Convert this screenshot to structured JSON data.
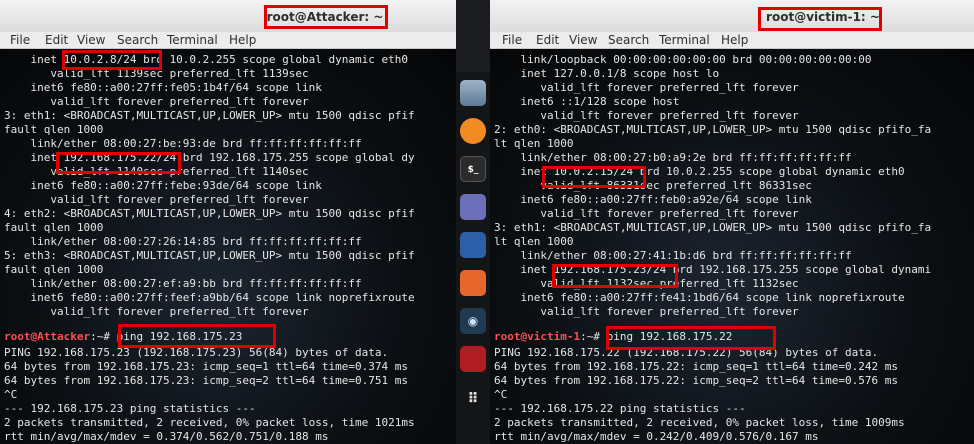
{
  "left_window": {
    "title": "root@Attacker: ~",
    "menu": [
      "File",
      "Edit",
      "View",
      "Search",
      "Terminal",
      "Help"
    ],
    "lines": [
      "    inet 10.0.2.8/24 brd 10.0.2.255 scope global dynamic eth0",
      "       valid_lft 1139sec preferred_lft 1139sec",
      "    inet6 fe80::a00:27ff:fe05:1b4f/64 scope link",
      "       valid_lft forever preferred_lft forever",
      "3: eth1: <BROADCAST,MULTICAST,UP,LOWER_UP> mtu 1500 qdisc pfif",
      "fault qlen 1000",
      "    link/ether 08:00:27:be:93:de brd ff:ff:ff:ff:ff:ff",
      "    inet 192.168.175.22/24 brd 192.168.175.255 scope global dy",
      "       valid_lft 1140sec preferred_lft 1140sec",
      "    inet6 fe80::a00:27ff:febe:93de/64 scope link",
      "       valid_lft forever preferred_lft forever",
      "4: eth2: <BROADCAST,MULTICAST,UP,LOWER_UP> mtu 1500 qdisc pfif",
      "fault qlen 1000",
      "    link/ether 08:00:27:26:14:85 brd ff:ff:ff:ff:ff:ff",
      "5: eth3: <BROADCAST,MULTICAST,UP,LOWER_UP> mtu 1500 qdisc pfif",
      "fault qlen 1000",
      "    link/ether 08:00:27:ef:a9:bb brd ff:ff:ff:ff:ff:ff",
      "    inet6 fe80::a00:27ff:feef:a9bb/64 scope link noprefixroute",
      "       valid_lft forever preferred_lft forever"
    ],
    "prompt": "root@Attacker",
    "prompt_rest": ":~# ping 192.168.175.23",
    "output_lines": [
      "PING 192.168.175.23 (192.168.175.23) 56(84) bytes of data.",
      "64 bytes from 192.168.175.23: icmp_seq=1 ttl=64 time=0.374 ms",
      "64 bytes from 192.168.175.23: icmp_seq=2 ttl=64 time=0.751 ms",
      "^C",
      "--- 192.168.175.23 ping statistics ---",
      "2 packets transmitted, 2 received, 0% packet loss, time 1021ms",
      "rtt min/avg/max/mdev = 0.374/0.562/0.751/0.188 ms"
    ]
  },
  "right_window": {
    "title": "root@victim-1: ~",
    "menu": [
      "File",
      "Edit",
      "View",
      "Search",
      "Terminal",
      "Help"
    ],
    "lines": [
      "    link/loopback 00:00:00:00:00:00 brd 00:00:00:00:00:00",
      "    inet 127.0.0.1/8 scope host lo",
      "       valid_lft forever preferred_lft forever",
      "    inet6 ::1/128 scope host",
      "       valid_lft forever preferred_lft forever",
      "2: eth0: <BROADCAST,MULTICAST,UP,LOWER_UP> mtu 1500 qdisc pfifo_fa",
      "lt qlen 1000",
      "    link/ether 08:00:27:b0:a9:2e brd ff:ff:ff:ff:ff:ff",
      "    inet 10.0.2.15/24 brd 10.0.2.255 scope global dynamic eth0",
      "       valid_lft 86331sec preferred_lft 86331sec",
      "    inet6 fe80::a00:27ff:feb0:a92e/64 scope link",
      "       valid_lft forever preferred_lft forever",
      "3: eth1: <BROADCAST,MULTICAST,UP,LOWER_UP> mtu 1500 qdisc pfifo_fa",
      "lt qlen 1000",
      "    link/ether 08:00:27:41:1b:d6 brd ff:ff:ff:ff:ff:ff",
      "    inet 192.168.175.23/24 brd 192.168.175.255 scope global dynami",
      "       valid_lft 1132sec preferred_lft 1132sec",
      "    inet6 fe80::a00:27ff:fe41:1bd6/64 scope link noprefixroute",
      "       valid_lft forever preferred_lft forever"
    ],
    "prompt": "root@victim-1",
    "prompt_rest": ":~# ping 192.168.175.22",
    "output_lines": [
      "PING 192.168.175.22 (192.168.175.22) 56(84) bytes of data.",
      "64 bytes from 192.168.175.22: icmp_seq=1 ttl=64 time=0.242 ms",
      "64 bytes from 192.168.175.22: icmp_seq=2 ttl=64 time=0.576 ms",
      "^C",
      "--- 192.168.175.22 ping statistics ---",
      "2 packets transmitted, 2 received, 0% packet loss, time 1009ms",
      "rtt min/avg/max/mdev = 0.242/0.409/0.576/0.167 ms"
    ]
  },
  "dock": {
    "icons": [
      "files-icon",
      "firefox-icon",
      "terminal-icon",
      "text-editor-icon",
      "metasploit-icon",
      "burpsuite-icon",
      "eye-icon",
      "cherrytree-icon",
      "app-grid-icon"
    ],
    "terminal_glyph": "$_"
  },
  "colors": {
    "prompt": "#ff4d4d",
    "highlight_box": "#e10000",
    "terminal_text": "#e6e6e6"
  }
}
